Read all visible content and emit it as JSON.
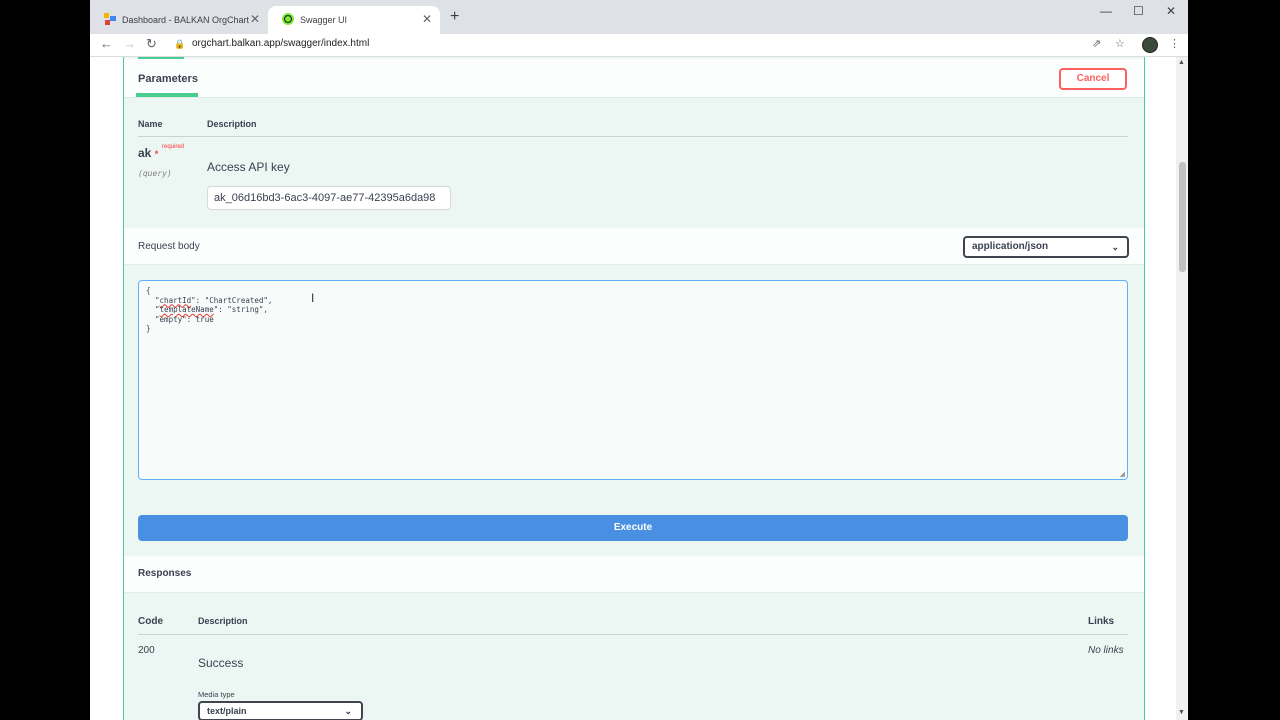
{
  "browser": {
    "tabs": [
      {
        "title": "Dashboard - BALKAN OrgChart",
        "active": false
      },
      {
        "title": "Swagger UI",
        "active": true
      }
    ],
    "url": "orgchart.balkan.app/swagger/index.html",
    "icons": {
      "back": "←",
      "forward": "→",
      "reload": "↻",
      "lock": "🔒",
      "open_external": "⇗",
      "bookmark": "☆",
      "menu": "⋮",
      "new_tab": "+",
      "minimize": "—",
      "maximize": "☐",
      "close": "✕",
      "tab_close": "✕"
    }
  },
  "parameters": {
    "title": "Parameters",
    "cancel_label": "Cancel",
    "col_name": "Name",
    "col_description": "Description",
    "param": {
      "name": "ak",
      "required_star": "*",
      "required_label": "required",
      "in": "(query)",
      "description": "Access API key",
      "value": "ak_06d16bd3-6ac3-4097-ae77-42395a6da98"
    }
  },
  "request_body": {
    "label": "Request body",
    "content_type": "application/json",
    "code_lines": {
      "l1": "{",
      "l2_indent": "  \"",
      "l2_key": "chartId",
      "l2_rest": "\": \"ChartCreated\",",
      "l3_indent": "  \"",
      "l3_key": "templateName",
      "l3_rest": "\": \"string\",",
      "l4": "  \"empty\": true",
      "l5": "}"
    }
  },
  "execute_label": "Execute",
  "responses": {
    "title": "Responses",
    "col_code": "Code",
    "col_description": "Description",
    "col_links": "Links",
    "rows": [
      {
        "code": "200",
        "description": "Success",
        "links": "No links"
      }
    ],
    "media_type_label": "Media type",
    "media_type_value": "text/plain"
  },
  "colors": {
    "accent_green": "#49cc90",
    "execute_blue": "#4990e2",
    "cancel_red": "#ff6060"
  }
}
